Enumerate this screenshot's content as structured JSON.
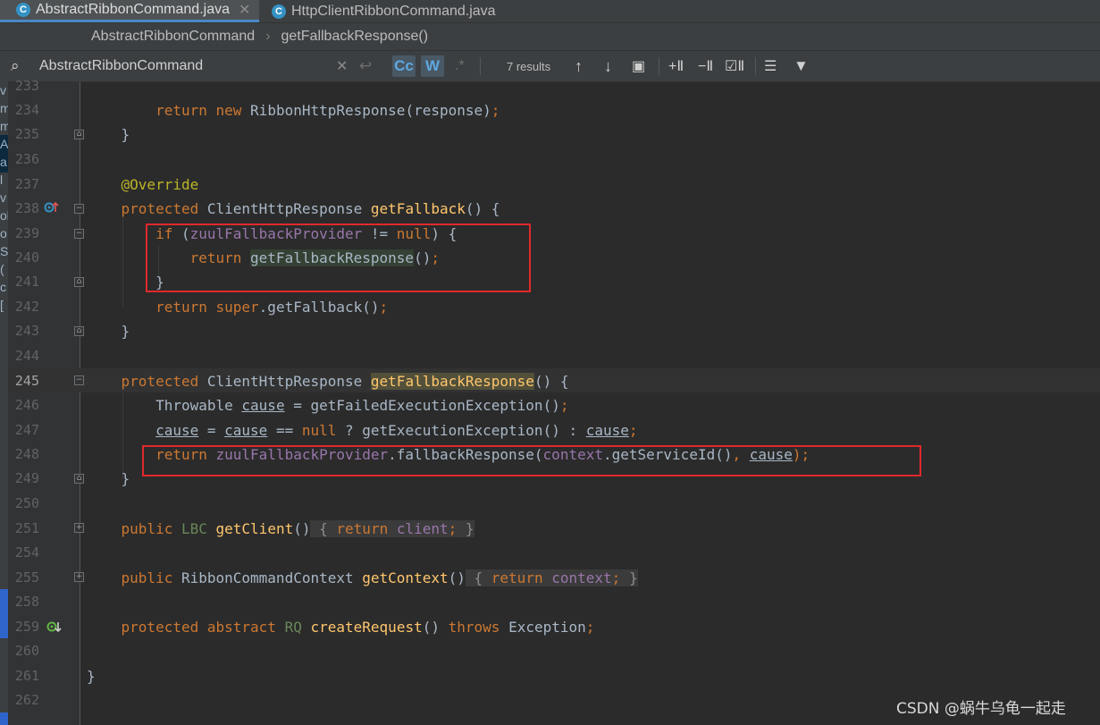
{
  "tabs": [
    {
      "label": "AbstractRibbonCommand.java",
      "icon": "java-class-icon",
      "active": true
    },
    {
      "label": "HttpClientRibbonCommand.java",
      "icon": "java-class-icon",
      "active": false
    }
  ],
  "breadcrumb": {
    "class_name": "AbstractRibbonCommand",
    "method_name": "getFallbackResponse()"
  },
  "find": {
    "query": "AbstractRibbonCommand",
    "match_case_label": "Cc",
    "words_label": "W",
    "regex_label": ".*",
    "results_text": "7 results"
  },
  "editor": {
    "current_line": "245",
    "lines": [
      {
        "num": "233"
      },
      {
        "num": "234"
      },
      {
        "num": "235"
      },
      {
        "num": "236"
      },
      {
        "num": "237"
      },
      {
        "num": "238"
      },
      {
        "num": "239"
      },
      {
        "num": "240"
      },
      {
        "num": "241"
      },
      {
        "num": "242"
      },
      {
        "num": "243"
      },
      {
        "num": "244"
      },
      {
        "num": "245"
      },
      {
        "num": "246"
      },
      {
        "num": "247"
      },
      {
        "num": "248"
      },
      {
        "num": "249"
      },
      {
        "num": "250"
      },
      {
        "num": "251"
      },
      {
        "num": "254"
      },
      {
        "num": "255"
      },
      {
        "num": "258"
      },
      {
        "num": "259"
      },
      {
        "num": "260"
      },
      {
        "num": "261"
      },
      {
        "num": "262"
      }
    ],
    "code": {
      "l234": [
        "return",
        "new",
        "RibbonHttpResponse(response)",
        ";"
      ],
      "l235": "}",
      "l237": "@Override",
      "l238": [
        "protected",
        "ClientHttpResponse",
        "getFallback",
        "() {"
      ],
      "l239": [
        "if",
        "(",
        "zuulFallbackProvider",
        " != ",
        "null",
        ") {"
      ],
      "l240": [
        "return",
        "getFallbackResponse",
        "()",
        ";"
      ],
      "l241": "}",
      "l242": [
        "return",
        "super",
        ".getFallback()",
        ";"
      ],
      "l243": "}",
      "l245": [
        "protected",
        "ClientHttpResponse",
        "getFallbackResponse",
        "() {"
      ],
      "l246": [
        "Throwable",
        "cause",
        " = getFailedExecutionException()",
        ";"
      ],
      "l247": [
        "cause",
        " = ",
        "cause",
        " == ",
        "null",
        " ? getExecutionException() : ",
        "cause",
        ";"
      ],
      "l248": [
        "return",
        "zuulFallbackProvider",
        ".fallbackResponse(",
        "context",
        ".getServiceId()",
        ", ",
        "cause",
        ");"
      ],
      "l249": "}",
      "l251": [
        "public",
        "LBC",
        "getClient",
        "()",
        "{",
        "return",
        "client",
        ";",
        "}"
      ],
      "l255": [
        "public",
        "RibbonCommandContext",
        "getContext",
        "()",
        "{",
        "return",
        "context",
        ";",
        "}"
      ],
      "l259": [
        "protected",
        "abstract",
        "RQ",
        "createRequest",
        "()",
        "throws",
        "Exception",
        ";"
      ],
      "l261": "}"
    }
  },
  "left_strip_letters": [
    "v",
    "m",
    "m",
    "A",
    "a",
    "l",
    "v",
    "ol",
    "o",
    "S",
    "(",
    "c",
    "["
  ],
  "watermark": "CSDN @蜗牛乌龟一起走",
  "colors": {
    "keyword": "#cc7832",
    "field": "#9876aa",
    "method_decl": "#ffc66d",
    "annotation": "#bbb529",
    "red_box": "#e0292c"
  }
}
